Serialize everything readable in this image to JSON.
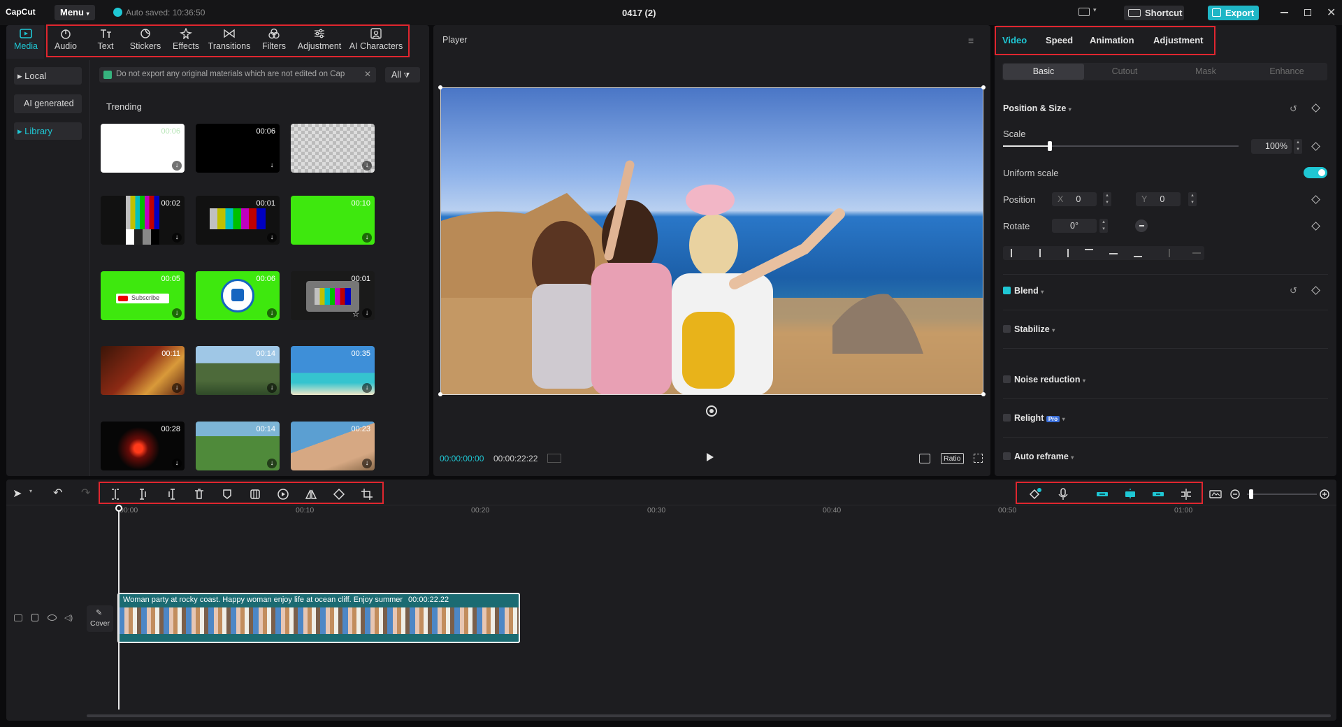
{
  "app": {
    "logo_text": "CapCut",
    "menu_label": "Menu",
    "autosave": "Auto saved: 10:36:50",
    "project_title": "0417 (2)",
    "shortcut_label": "Shortcut",
    "export_label": "Export"
  },
  "toolbar": {
    "tabs": [
      "Media",
      "Audio",
      "Text",
      "Stickers",
      "Effects",
      "Transitions",
      "Filters",
      "Adjustment",
      "AI Characters"
    ]
  },
  "left_nav": {
    "items": [
      "Local",
      "AI generated",
      "Library"
    ]
  },
  "library": {
    "notice": "Do not export any original materials which are not edited on Cap",
    "filter_label": "All",
    "section_title": "Trending",
    "items": [
      {
        "duration": "00:06"
      },
      {
        "duration": "00:06"
      },
      {
        "duration": ""
      },
      {
        "duration": "00:02"
      },
      {
        "duration": "00:01"
      },
      {
        "duration": "00:10"
      },
      {
        "duration": "00:05",
        "label": "Subscribe"
      },
      {
        "duration": "00:06"
      },
      {
        "duration": "00:01"
      },
      {
        "duration": "00:11"
      },
      {
        "duration": "00:14"
      },
      {
        "duration": "00:35"
      },
      {
        "duration": "00:28"
      },
      {
        "duration": "00:14"
      },
      {
        "duration": "00:23"
      }
    ]
  },
  "player": {
    "title": "Player",
    "current_time": "00:00:00:00",
    "total_time": "00:00:22:22",
    "ratio_label": "Ratio"
  },
  "inspector": {
    "tabs": [
      "Video",
      "Speed",
      "Animation",
      "Adjustment"
    ],
    "subtabs": [
      "Basic",
      "Cutout",
      "Mask",
      "Enhance"
    ],
    "position_size": "Position & Size",
    "scale_label": "Scale",
    "scale_value": "100%",
    "scale_fraction": 0.2,
    "uniform_scale": "Uniform scale",
    "position_label": "Position",
    "x_label": "X",
    "x_value": "0",
    "y_label": "Y",
    "y_value": "0",
    "rotate_label": "Rotate",
    "rotate_value": "0°",
    "blend": "Blend",
    "stabilize": "Stabilize",
    "noise_reduction": "Noise reduction",
    "relight": "Relight",
    "relight_badge": "Pro",
    "auto_reframe": "Auto reframe"
  },
  "timeline": {
    "ruler": [
      "00:00",
      "00:10",
      "00:20",
      "00:30",
      "00:40",
      "00:50",
      "01:00"
    ],
    "clip_title": "Woman party at rocky coast. Happy woman enjoy life at ocean cliff. Enjoy summer",
    "clip_duration": "00:00:22.22",
    "cover_label": "Cover"
  },
  "colors": {
    "accent": "#1fc7d4",
    "red_highlight": "#e0262f",
    "export_button": "#1fb6c6",
    "clip": "#1b6b72"
  }
}
